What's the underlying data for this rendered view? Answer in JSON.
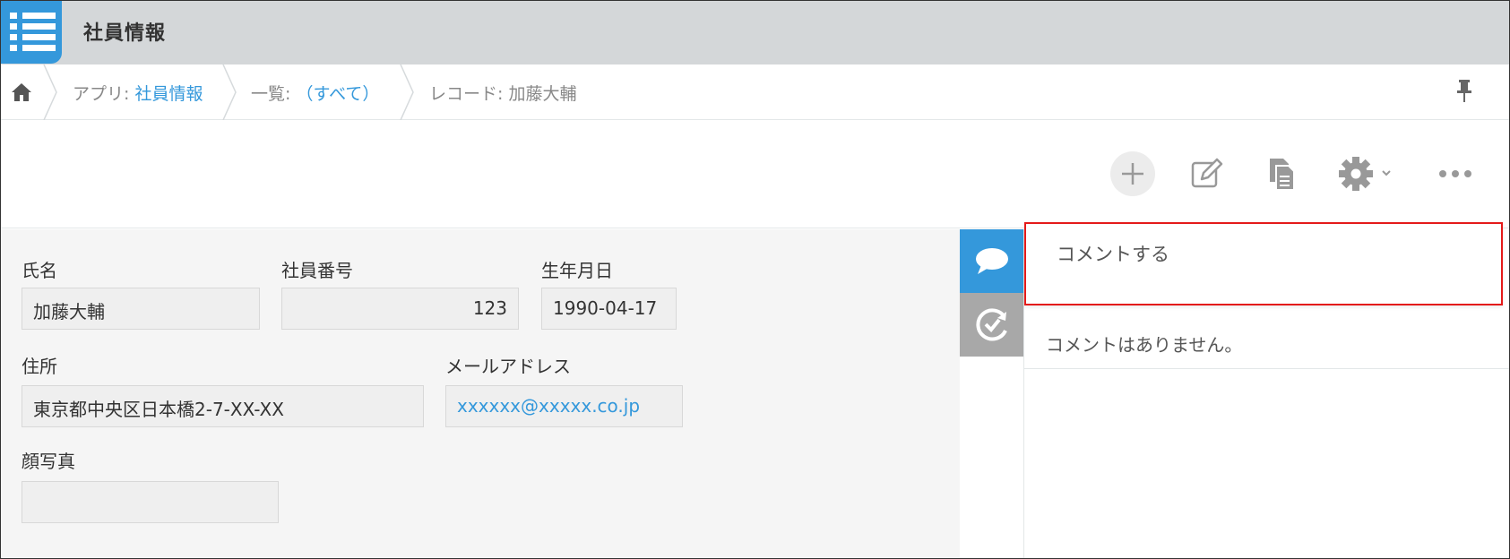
{
  "app": {
    "title": "社員情報"
  },
  "breadcrumb": {
    "app_prefix": "アプリ: ",
    "app_name": "社員情報",
    "list_prefix": "一覧: ",
    "list_name": "（すべて）",
    "record_prefix": "レコード: ",
    "record_name": "加藤大輔"
  },
  "toolbar": {
    "icons": [
      "plus-icon",
      "edit-icon",
      "duplicate-icon",
      "gear-icon",
      "more-icon"
    ]
  },
  "record": {
    "name": {
      "label": "氏名",
      "value": "加藤大輔"
    },
    "employee_no": {
      "label": "社員番号",
      "value": "123"
    },
    "birthday": {
      "label": "生年月日",
      "value": "1990-04-17"
    },
    "address": {
      "label": "住所",
      "value": "東京都中央区日本橋2-7-XX-XX"
    },
    "email": {
      "label": "メールアドレス",
      "value": "xxxxxx@xxxxx.co.jp"
    },
    "photo": {
      "label": "顔写真",
      "value": ""
    }
  },
  "comments": {
    "placeholder": "コメントする",
    "empty_message": "コメントはありません。"
  },
  "colors": {
    "accent": "#3498db",
    "header_bg": "#d4d7d9",
    "highlight": "#e41a1a"
  }
}
